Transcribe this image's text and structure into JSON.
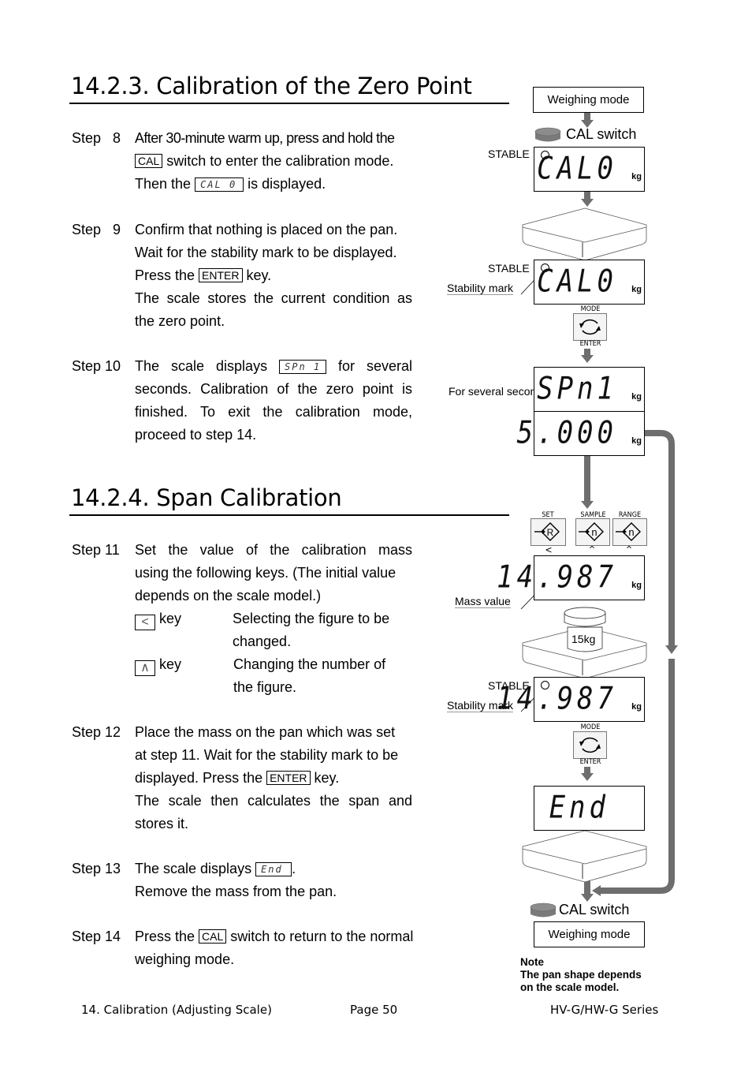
{
  "sections": [
    {
      "title": "14.2.3. Calibration of the Zero Point"
    },
    {
      "title": "14.2.4. Span Calibration"
    }
  ],
  "steps": {
    "s8": {
      "label": "Step   8",
      "l1": "After 30-minute warm up, press and hold the",
      "cal_key": "CAL",
      "l2": " switch to enter the calibration mode.",
      "l3a": "Then the ",
      "lcd": "CAL 0",
      "l3b": " is displayed."
    },
    "s9": {
      "label": "Step   9",
      "l1": "Confirm that nothing is placed on the pan.",
      "l2": "Wait for the stability mark to be displayed.",
      "l3a": "Press the ",
      "enter_key": "ENTER",
      "l3b": " key.",
      "l4": "The scale stores the current condition as",
      "l5": "the zero point."
    },
    "s10": {
      "label": "Step 10",
      "l1a": "The scale displays",
      "lcd": "SPn 1",
      "l1b": "for several",
      "l2": "seconds. Calibration of the zero point is",
      "l3": "finished. To exit the calibration mode,",
      "l4": "proceed to step 14."
    },
    "s11": {
      "label": "Step 11",
      "l1": "Set the value of the calibration mass",
      "l2": "using the following keys. (The initial value",
      "l3": "depends on the scale model.)",
      "keys": [
        {
          "symbol": "<",
          "word": "key",
          "desc1": "Selecting the figure to be",
          "desc2": "changed."
        },
        {
          "symbol": "∧",
          "word": "key",
          "desc1": "Changing the number of",
          "desc2": "the figure."
        }
      ]
    },
    "s12": {
      "label": "Step 12",
      "l1": "Place the mass on the pan which was set",
      "l2": "at step 11. Wait for the stability mark to be",
      "l3a": "displayed. Press the ",
      "enter_key": "ENTER",
      "l3b": " key.",
      "l4": "The scale then calculates the span and",
      "l5": "stores it."
    },
    "s13": {
      "label": "Step 13",
      "l1a": "The scale displays ",
      "lcd": "End",
      "l1b": ".",
      "l2": "Remove the mass from the pan."
    },
    "s14": {
      "label": "Step 14",
      "l1a": "Press the ",
      "cal_key": "CAL",
      "l1b": " switch to return to the normal",
      "l2": "weighing mode."
    }
  },
  "diagram": {
    "weighing_mode_top": "Weighing mode",
    "cal_switch_top": "CAL switch",
    "stable": "STABLE",
    "stability_mark": "Stability mark",
    "for_several_seconds": "For several seconds",
    "mass_value": "Mass value",
    "unit": "kg",
    "displays": {
      "cal0_a": "CAL0",
      "cal0_b": "CAL0",
      "spn1": "SPn1",
      "initial": "5.000",
      "mass_a": "14.987",
      "mass_b": "14.987",
      "end": "End"
    },
    "mode_key": {
      "top": "MODE",
      "bottom": "ENTER"
    },
    "set_key": {
      "top": "SET",
      "glyph": "R",
      "arrow": "<"
    },
    "sample_key": {
      "top": "SAMPLE",
      "glyph": "n",
      "arrow": "^"
    },
    "range_key": {
      "top": "RANGE",
      "glyph": "n",
      "arrow": "^"
    },
    "weight_label": "15kg",
    "cal_switch_bottom": "CAL switch",
    "weighing_mode_bottom": "Weighing mode",
    "note": {
      "title": "Note",
      "l1": "The pan shape depends",
      "l2": "on the scale model."
    }
  },
  "colors": {
    "arrow": "#6e6e6e",
    "switch": "#7a7a7a"
  },
  "footer": {
    "left": "14. Calibration (Adjusting Scale)",
    "center": "Page 50",
    "right": "HV-G/HW-G Series"
  }
}
